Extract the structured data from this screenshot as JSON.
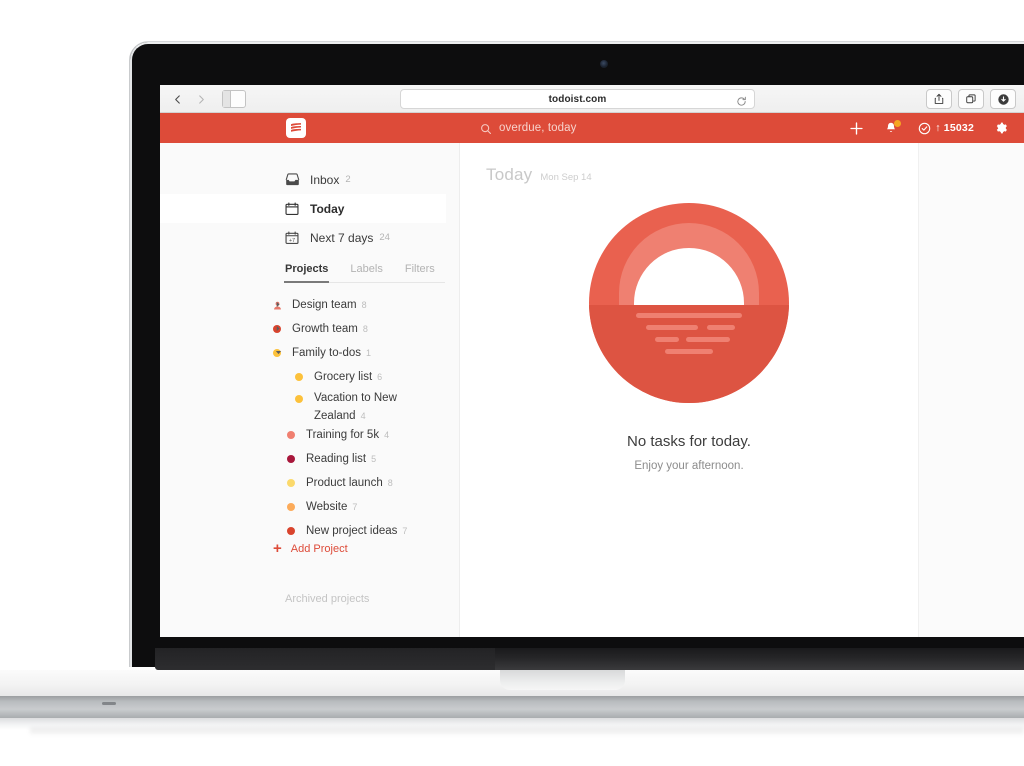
{
  "browser": {
    "back_icon": "chevron-left-icon",
    "forward_icon": "chevron-right-icon",
    "sidebar_icon": "sidebar-toggle-icon",
    "url": "todoist.com",
    "reload_icon": "reload-icon",
    "share_icon": "share-icon",
    "tabs_icon": "tabs-icon",
    "downloads_icon": "download-icon"
  },
  "appbar": {
    "brand_color": "#dd4b39",
    "logo_icon": "todoist-logo-icon",
    "search_icon": "search-icon",
    "search_text": "overdue, today",
    "add_icon": "plus-icon",
    "notifications_icon": "bell-icon",
    "karma_icon": "karma-icon",
    "karma_value": "15032",
    "karma_arrow": "↑",
    "settings_icon": "gear-icon"
  },
  "sidebar": {
    "nav": [
      {
        "label": "Inbox",
        "count": "2",
        "icon": "inbox-icon",
        "active": false
      },
      {
        "label": "Today",
        "count": "",
        "icon": "calendar-icon",
        "active": true
      },
      {
        "label": "Next 7 days",
        "count": "24",
        "icon": "calendar-7-icon",
        "active": false
      }
    ],
    "tabs": [
      {
        "label": "Projects",
        "active": true
      },
      {
        "label": "Labels",
        "active": false
      },
      {
        "label": "Filters",
        "active": false
      }
    ],
    "projects": [
      {
        "label": "Design team",
        "count": "8",
        "color": "#e8796b",
        "shared": true,
        "arrow": "collapsed",
        "indent": 0
      },
      {
        "label": "Growth team",
        "count": "8",
        "color": "#d9442d",
        "shared": false,
        "arrow": "collapsed",
        "indent": 0
      },
      {
        "label": "Family to-dos",
        "count": "1",
        "color": "#fcc13b",
        "shared": false,
        "arrow": "expanded",
        "indent": 0
      },
      {
        "label": "Grocery list",
        "count": "6",
        "color": "#fcc13b",
        "shared": false,
        "arrow": "",
        "indent": 1
      },
      {
        "label": "Vacation to New Zealand",
        "count": "4",
        "color": "#fcc13b",
        "shared": false,
        "arrow": "",
        "indent": 1
      },
      {
        "label": "Training for 5k",
        "count": "4",
        "color": "#f07f70",
        "shared": false,
        "arrow": "",
        "indent": 0
      },
      {
        "label": "Reading list",
        "count": "5",
        "color": "#a8173b",
        "shared": false,
        "arrow": "",
        "indent": 0
      },
      {
        "label": "Product launch",
        "count": "8",
        "color": "#fbd96b",
        "shared": false,
        "arrow": "",
        "indent": 0
      },
      {
        "label": "Website",
        "count": "7",
        "color": "#fcab5a",
        "shared": false,
        "arrow": "",
        "indent": 0
      },
      {
        "label": "New project ideas",
        "count": "7",
        "color": "#d9442d",
        "shared": false,
        "arrow": "",
        "indent": 0
      }
    ],
    "add_project": {
      "label": "Add Project",
      "icon": "plus-icon",
      "color": "#dd4b39"
    },
    "archived": "Archived projects"
  },
  "content": {
    "title": "Today",
    "date": "Mon Sep 14",
    "illustration": "sunset-illustration",
    "empty_title": "No tasks for today.",
    "empty_subtitle": "Enjoy your afternoon."
  }
}
